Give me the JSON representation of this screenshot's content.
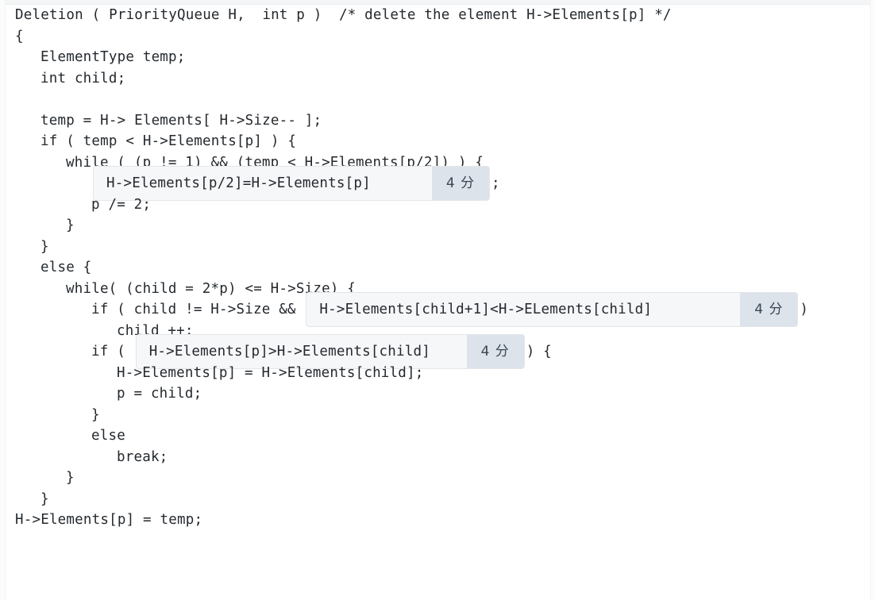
{
  "document": {
    "language": "C",
    "title": "Deletion ( PriorityQueue H,  int p )"
  },
  "score_badge_label": "4 分",
  "code": {
    "lines": [
      {
        "id": "l1",
        "indent": 0,
        "text": "Deletion ( PriorityQueue H,  int p )  /* delete the element H->Elements[p] */"
      },
      {
        "id": "l2",
        "indent": 0,
        "text": "{"
      },
      {
        "id": "l3",
        "indent": 1,
        "text": "ElementType temp;"
      },
      {
        "id": "l4",
        "indent": 1,
        "text": "int child;"
      },
      {
        "id": "l5",
        "indent": 0,
        "text": ""
      },
      {
        "id": "l6",
        "indent": 1,
        "text": "temp = H-> Elements[ H->Size-- ];"
      },
      {
        "id": "l7",
        "indent": 1,
        "text": "if ( temp < H->Elements[p] ) {"
      },
      {
        "id": "l8",
        "indent": 2,
        "text": "while ( (p != 1) && (temp < H->Elements[p/2]) ) {"
      },
      {
        "id": "l9",
        "indent": 3,
        "blank": 1,
        "prefix": "",
        "suffix": ";"
      },
      {
        "id": "l10",
        "indent": 3,
        "text": "p /= 2;"
      },
      {
        "id": "l11",
        "indent": 2,
        "text": "}"
      },
      {
        "id": "l12",
        "indent": 1,
        "text": "}"
      },
      {
        "id": "l13",
        "indent": 1,
        "text": "else {"
      },
      {
        "id": "l14",
        "indent": 2,
        "text": "while( (child = 2*p) <= H->Size) {"
      },
      {
        "id": "l15",
        "indent": 3,
        "blank": 2,
        "prefix": "if ( child != H->Size && ",
        "suffix": ")"
      },
      {
        "id": "l16",
        "indent": 4,
        "text": "child ++;"
      },
      {
        "id": "l17",
        "indent": 3,
        "blank": 3,
        "prefix": "if ( ",
        "suffix": ") {"
      },
      {
        "id": "l18",
        "indent": 4,
        "text": "H->Elements[p] = H->Elements[child];"
      },
      {
        "id": "l19",
        "indent": 4,
        "text": "p = child;"
      },
      {
        "id": "l20",
        "indent": 3,
        "text": "}"
      },
      {
        "id": "l21",
        "indent": 3,
        "text": "else"
      },
      {
        "id": "l22",
        "indent": 4,
        "text": "break;"
      },
      {
        "id": "l23",
        "indent": 2,
        "text": "}"
      },
      {
        "id": "l24",
        "indent": 1,
        "text": "}"
      },
      {
        "id": "l25",
        "indent": 0,
        "text": "H->Elements[p] = temp;"
      }
    ]
  },
  "blanks": [
    {
      "id": "blank-1",
      "answer": "H->Elements[p/2]=H->Elements[p]",
      "score": "4 分",
      "field_width": 500,
      "placeholder": ""
    },
    {
      "id": "blank-2",
      "answer": "H->Elements[child+1]<H->ELements[child]",
      "score": "4 分",
      "field_width": 620,
      "placeholder": ""
    },
    {
      "id": "blank-3",
      "answer": "H->Elements[p]>H->Elements[child]",
      "score": "4 分",
      "field_width": 490,
      "placeholder": ""
    }
  ]
}
